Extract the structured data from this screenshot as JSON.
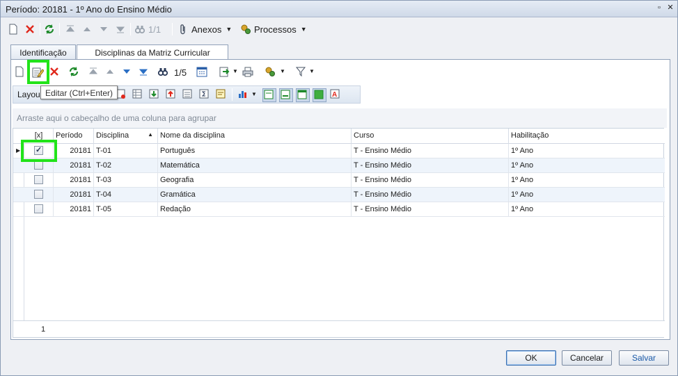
{
  "window": {
    "title": "Período: 20181 - 1º Ano do Ensino Médio"
  },
  "toolbar_top": {
    "nav_position": "1/1",
    "anexos_label": "Anexos",
    "processos_label": "Processos"
  },
  "tabs": [
    {
      "label": "Identificação"
    },
    {
      "label": "Disciplinas da Matriz Curricular"
    }
  ],
  "toolbar_grid": {
    "nav_position": "1/5",
    "layout_label": "Layou"
  },
  "tooltip": "Editar (Ctrl+Enter)",
  "group_hint": "Arraste aqui o cabeçalho de uma coluna para agrupar",
  "grid": {
    "columns": [
      "[x]",
      "Período",
      "Disciplina",
      "Nome da disciplina",
      "Curso",
      "Habilitação"
    ],
    "rows": [
      {
        "checked": true,
        "periodo": "20181",
        "disciplina": "T-01",
        "nome": "Português",
        "curso": "T - Ensino Médio",
        "habilitacao": "1º Ano"
      },
      {
        "checked": false,
        "periodo": "20181",
        "disciplina": "T-02",
        "nome": "Matemática",
        "curso": "T - Ensino Médio",
        "habilitacao": "1º Ano"
      },
      {
        "checked": false,
        "periodo": "20181",
        "disciplina": "T-03",
        "nome": "Geografia",
        "curso": "T - Ensino Médio",
        "habilitacao": "1º Ano"
      },
      {
        "checked": false,
        "periodo": "20181",
        "disciplina": "T-04",
        "nome": "Gramática",
        "curso": "T - Ensino Médio",
        "habilitacao": "1º Ano"
      },
      {
        "checked": false,
        "periodo": "20181",
        "disciplina": "T-05",
        "nome": "Redação",
        "curso": "T - Ensino Médio",
        "habilitacao": "1º Ano"
      }
    ],
    "footer_count": "1"
  },
  "buttons": {
    "ok": "OK",
    "cancel": "Cancelar",
    "save": "Salvar"
  },
  "colors": {
    "highlight": "#22e31a",
    "row_alt": "#eef4fb"
  }
}
